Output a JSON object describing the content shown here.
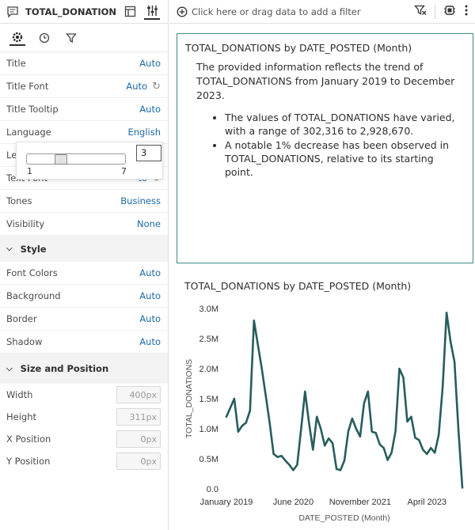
{
  "panel": {
    "title": "TOTAL_DONATION...",
    "properties": [
      {
        "label": "Title",
        "value": "Auto"
      },
      {
        "label": "Title Font",
        "value": "Auto"
      },
      {
        "label": "Title Tooltip",
        "value": "Auto"
      },
      {
        "label": "Language",
        "value": "English"
      },
      {
        "label": "Le",
        "value": ""
      },
      {
        "label": "Text Font",
        "value": "to"
      },
      {
        "label": "Tones",
        "value": "Business"
      },
      {
        "label": "Visibility",
        "value": "None"
      }
    ],
    "style_section": "Style",
    "style_props": [
      {
        "label": "Font Colors",
        "value": "Auto"
      },
      {
        "label": "Background",
        "value": "Auto"
      },
      {
        "label": "Border",
        "value": "Auto"
      },
      {
        "label": "Shadow",
        "value": "Auto"
      }
    ],
    "size_section": "Size and Position",
    "size_props": [
      {
        "label": "Width",
        "value": "400px"
      },
      {
        "label": "Height",
        "value": "311px"
      },
      {
        "label": "X Position",
        "value": "0px"
      },
      {
        "label": "Y Position",
        "value": "0px"
      }
    ],
    "slider": {
      "min": "1",
      "max": "7",
      "value": "3",
      "level": 3
    }
  },
  "filterbar": {
    "hint": "Click here or drag data to add a filter"
  },
  "narrative": {
    "title": "TOTAL_DONATIONS by DATE_POSTED (Month)",
    "para": "The provided information reflects the trend of TOTAL_DONATIONS from January 2019 to December 2023.",
    "bullets": [
      "The values of TOTAL_DONATIONS have varied, with a range of 302,316 to 2,928,670.",
      "A notable 1% decrease has been observed in TOTAL_DONATIONS, relative to its starting point."
    ]
  },
  "chart_title": "TOTAL_DONATIONS by DATE_POSTED (Month)",
  "colors": {
    "line": "#275d5b",
    "accent": "#1c6aa6",
    "border": "#3f8a8a"
  },
  "chart_data": {
    "type": "line",
    "title": "TOTAL_DONATIONS by DATE_POSTED (Month)",
    "xlabel": "DATE_POSTED (Month)",
    "ylabel": "TOTAL_DONATIONS",
    "ylim": [
      0,
      3000000
    ],
    "yticks": [
      "0.0",
      "0.5M",
      "1.0M",
      "1.5M",
      "2.0M",
      "2.5M",
      "3.0M"
    ],
    "xticks": [
      {
        "label": "January 2019",
        "index": 0
      },
      {
        "label": "June 2020",
        "index": 17
      },
      {
        "label": "November 2021",
        "index": 34
      },
      {
        "label": "April 2023",
        "index": 51
      }
    ],
    "grid": false,
    "series": [
      {
        "values": [
          1200000,
          1350000,
          1500000,
          950000,
          1050000,
          1100000,
          1300000,
          2800000,
          2400000,
          2000000,
          1550000,
          1100000,
          580000,
          530000,
          550000,
          470000,
          400000,
          310000,
          400000,
          1000000,
          1620000,
          1100000,
          650000,
          1200000,
          1000000,
          720000,
          840000,
          760000,
          330000,
          310000,
          470000,
          960000,
          1170000,
          1000000,
          870000,
          1420000,
          1620000,
          950000,
          930000,
          740000,
          680000,
          480000,
          600000,
          960000,
          2000000,
          1850000,
          1120000,
          1200000,
          850000,
          810000,
          650000,
          580000,
          680000,
          600000,
          900000,
          1700000,
          2930000,
          2450000,
          2110000,
          1000000,
          20000
        ]
      }
    ]
  }
}
